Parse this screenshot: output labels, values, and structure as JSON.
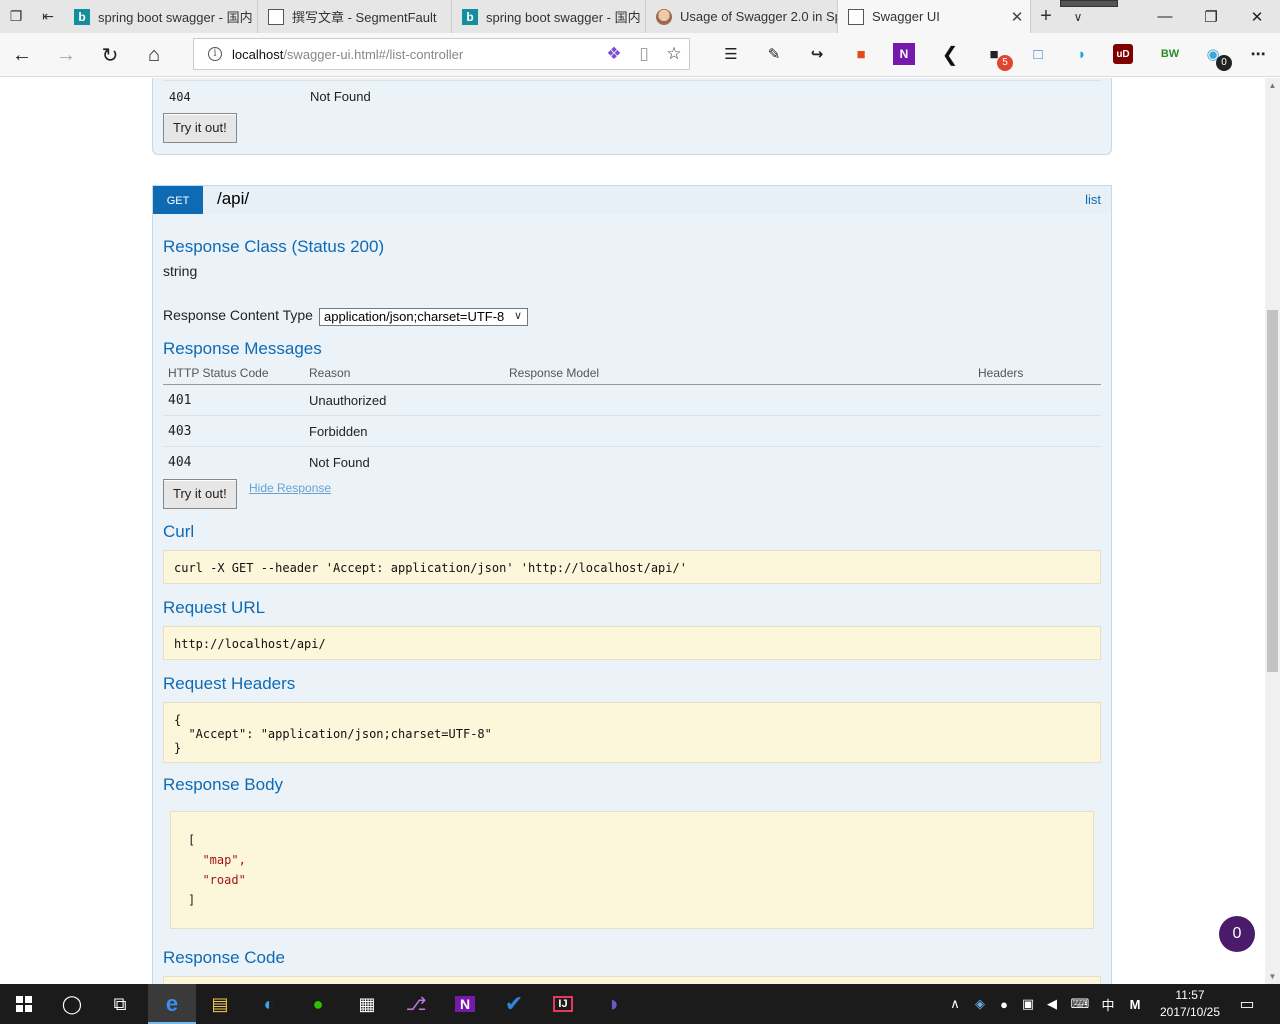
{
  "browser": {
    "tabs": [
      {
        "title": "spring boot swagger - 国内",
        "favicon": "bing-icon",
        "active": false
      },
      {
        "title": "撰写文章 - SegmentFault",
        "favicon": "page-icon",
        "active": false
      },
      {
        "title": "spring boot swagger - 国内",
        "favicon": "bing-icon",
        "active": false
      },
      {
        "title": "Usage of Swagger 2.0 in Sp",
        "favicon": "person-icon",
        "active": false
      },
      {
        "title": "Swagger UI",
        "favicon": "page-icon",
        "active": true
      }
    ],
    "address": {
      "host": "localhost",
      "path": "/swagger-ui.html#/list-controller"
    },
    "extension_badges": {
      "five": "5",
      "zero": "0"
    }
  },
  "previous_operation": {
    "last_row": {
      "code": "404",
      "reason": "Not Found"
    },
    "try_button": "Try it out!"
  },
  "operation": {
    "method": "GET",
    "path": "/api/",
    "nickname": "list",
    "response_class_title": "Response Class (Status 200)",
    "response_class_type": "string",
    "content_type_label": "Response Content Type",
    "content_type_value": "application/json;charset=UTF-8",
    "messages_title": "Response Messages",
    "messages_headers": [
      "HTTP Status Code",
      "Reason",
      "Response Model",
      "Headers"
    ],
    "messages": [
      {
        "code": "401",
        "reason": "Unauthorized"
      },
      {
        "code": "403",
        "reason": "Forbidden"
      },
      {
        "code": "404",
        "reason": "Not Found"
      }
    ],
    "try_button": "Try it out!",
    "hide_response": "Hide Response",
    "curl_title": "Curl",
    "curl": "curl -X GET --header 'Accept: application/json' 'http://localhost/api/'",
    "request_url_title": "Request URL",
    "request_url": "http://localhost/api/",
    "request_headers_title": "Request Headers",
    "request_headers": "{\n  \"Accept\": \"application/json;charset=UTF-8\"\n}",
    "response_body_title": "Response Body",
    "response_body": {
      "open": "[",
      "items": [
        "\"map\",",
        "\"road\""
      ],
      "close": "]"
    },
    "response_code_title": "Response Code"
  },
  "chat_count": "0",
  "taskbar": {
    "ime": "中",
    "ime_mode": "M",
    "time": "11:57",
    "date": "2017/10/25"
  },
  "colors": {
    "accent": "#0f6ab4",
    "operation_bg": "#ebf3f9",
    "code_bg": "#fcf6db",
    "taskbar": "#1b1b1b"
  }
}
